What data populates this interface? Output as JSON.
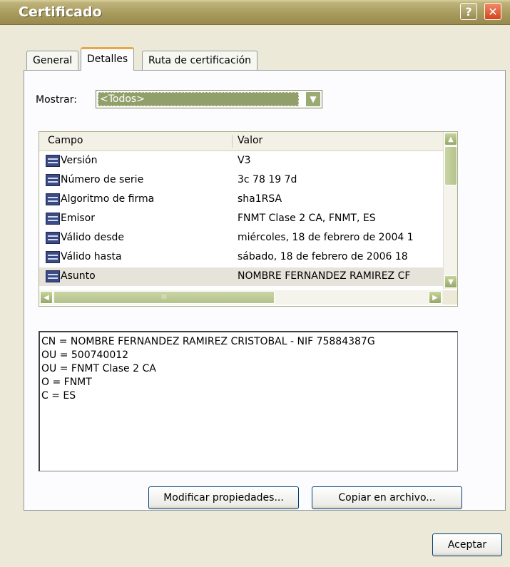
{
  "window": {
    "title": "Certificado",
    "help_glyph": "?",
    "close_glyph": "✕"
  },
  "tabs": [
    {
      "label": "General"
    },
    {
      "label": "Detalles"
    },
    {
      "label": "Ruta de certificación"
    }
  ],
  "show": {
    "label": "Mostrar:",
    "selected": "<Todos>"
  },
  "list": {
    "columns": {
      "field": "Campo",
      "value": "Valor"
    },
    "rows": [
      {
        "field": "Versión",
        "value": "V3"
      },
      {
        "field": "Número de serie",
        "value": "3c 78 19 7d"
      },
      {
        "field": "Algoritmo de firma",
        "value": "sha1RSA"
      },
      {
        "field": "Emisor",
        "value": "FNMT Clase 2 CA, FNMT, ES"
      },
      {
        "field": "Válido desde",
        "value": "miércoles, 18 de febrero de 2004 1"
      },
      {
        "field": "Válido hasta",
        "value": "sábado, 18 de febrero de 2006 18"
      },
      {
        "field": "Asunto",
        "value": "NOMBRE FERNANDEZ RAMIREZ CF"
      }
    ],
    "hscroll_grip": "III"
  },
  "detail": {
    "lines": [
      "CN = NOMBRE FERNANDEZ RAMIREZ CRISTOBAL - NIF 75884387G",
      "OU = 500740012",
      "OU = FNMT Clase 2 CA",
      "O = FNMT",
      "C = ES"
    ]
  },
  "buttons": {
    "modify": "Modificar propiedades...",
    "copy": "Copiar en archivo...",
    "ok": "Aceptar"
  }
}
